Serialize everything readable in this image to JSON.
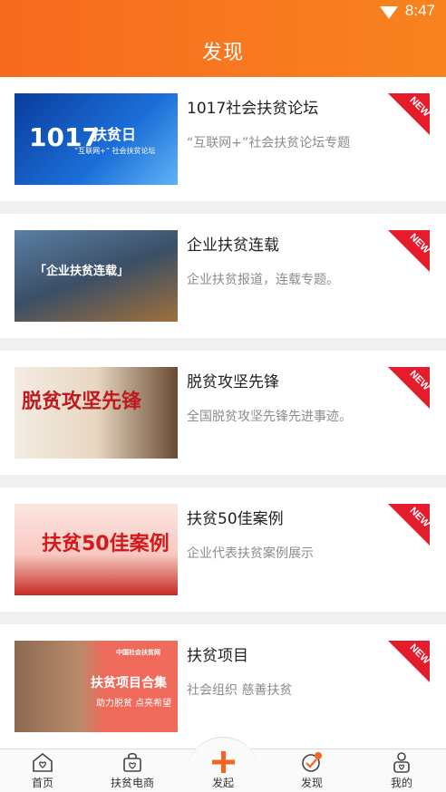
{
  "status": {
    "time": "8:47"
  },
  "header": {
    "title": "发现"
  },
  "cards": [
    {
      "title": "1017社会扶贫论坛",
      "desc": "“互联网+”社会扶贫论坛专题",
      "badge": "NEW",
      "thumb_text": [
        "1017",
        "扶贫日",
        "“互联网+” 社会扶贫论坛"
      ]
    },
    {
      "title": "企业扶贫连载",
      "desc": "企业扶贫报道，连载专题。",
      "badge": "NEW",
      "thumb_text": [
        "「企业扶贫连载」"
      ]
    },
    {
      "title": "脱贫攻坚先锋",
      "desc": "全国脱贫攻坚先锋先进事迹。",
      "badge": "NEW",
      "thumb_text": [
        "脱贫攻坚先锋"
      ]
    },
    {
      "title": "扶贫50佳案例",
      "desc": "企业代表扶贫案例展示",
      "badge": "NEW",
      "thumb_text": [
        "扶贫50佳案例"
      ]
    },
    {
      "title": "扶贫项目",
      "desc": "社会组织 慈善扶贫",
      "badge": "NEW",
      "thumb_text": [
        "中国社会扶贫网",
        "扶贫项目合集",
        "助力脱贫 点亮希望"
      ]
    }
  ],
  "tabbar": {
    "items": [
      "首页",
      "扶贫电商",
      "发起",
      "发现",
      "我的"
    ],
    "active": "发现"
  },
  "colors": {
    "header": "#f76a1f",
    "badge": "#e51c2b",
    "accent": "#f26522"
  }
}
